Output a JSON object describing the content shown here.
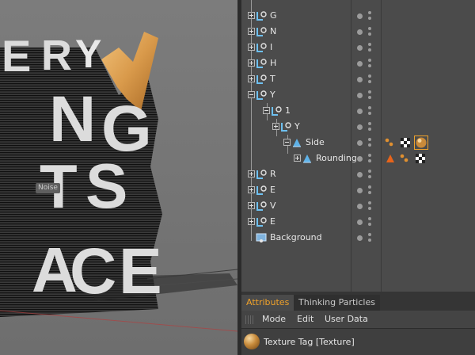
{
  "viewport": {
    "label": "Noise",
    "letters": [
      "E",
      "R",
      "Y",
      "N",
      "G",
      "T",
      "S",
      "A",
      "C",
      "E"
    ]
  },
  "object_manager": {
    "rows": [
      {
        "label": "G",
        "depth": 0
      },
      {
        "label": "N",
        "depth": 0
      },
      {
        "label": "I",
        "depth": 0
      },
      {
        "label": "H",
        "depth": 0
      },
      {
        "label": "T",
        "depth": 0
      },
      {
        "label": "Y",
        "depth": 0
      },
      {
        "label": "1",
        "depth": 1
      },
      {
        "label": "Y",
        "depth": 2
      },
      {
        "label": "Side",
        "depth": 3
      },
      {
        "label": "Rounding",
        "depth": 4
      },
      {
        "label": "R",
        "depth": 0
      },
      {
        "label": "E",
        "depth": 0
      },
      {
        "label": "V",
        "depth": 0
      },
      {
        "label": "E",
        "depth": 0
      },
      {
        "label": "Background",
        "depth": 0
      }
    ]
  },
  "attributes": {
    "tabs": [
      "Attributes",
      "Thinking Particles"
    ],
    "menu": [
      "Mode",
      "Edit",
      "User Data"
    ],
    "object_line": "Texture Tag [Texture]"
  },
  "colors": {
    "accent": "#f0a22a",
    "panel": "#4b4b4b",
    "text": "#e6e6e6"
  }
}
